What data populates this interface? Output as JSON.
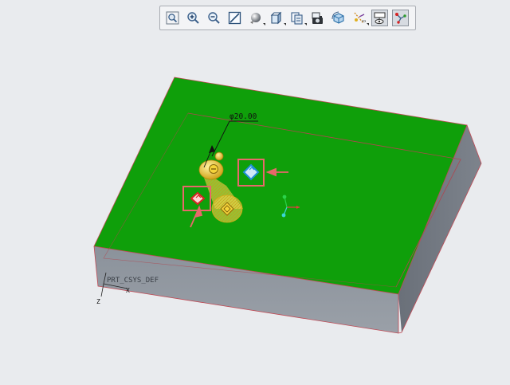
{
  "toolbar": {
    "buttons": [
      {
        "name": "refit-button",
        "icon": "zoom-fit-icon"
      },
      {
        "name": "zoom-in-button",
        "icon": "zoom-in-icon"
      },
      {
        "name": "zoom-out-button",
        "icon": "zoom-out-icon"
      },
      {
        "name": "repaint-button",
        "icon": "repaint-icon"
      },
      {
        "name": "display-style-button",
        "icon": "shading-icon",
        "has_menu": true
      },
      {
        "name": "saved-orientations-button",
        "icon": "view-cube-icon",
        "has_menu": true
      },
      {
        "name": "view-manager-button",
        "icon": "view-manager-icon",
        "has_menu": true
      },
      {
        "name": "perspective-button",
        "icon": "camera-icon"
      },
      {
        "name": "spin-center-button",
        "icon": "cube-spin-icon"
      },
      {
        "name": "datum-display-button",
        "icon": "datum-icon",
        "has_menu": true
      },
      {
        "name": "annotation-display-button",
        "icon": "annotation-icon",
        "active": true
      },
      {
        "name": "sketch-display-button",
        "icon": "sketch-icon",
        "active": true
      }
    ]
  },
  "viewport": {
    "dimension_label": "φ20.00",
    "csys_label": "PRT_CSYS_DEF",
    "axis_x_label": "X",
    "axis_z_label": "Z",
    "colors": {
      "top_face": "#0f9f0a",
      "side_front": "#8f959e",
      "side_right": "#6c727b",
      "edge": "#c04a55",
      "handle_yellow": "#e7c01f",
      "callout": "#e8686a",
      "handle_blue": "#1f8fd8",
      "background": "#e9ebee"
    }
  }
}
